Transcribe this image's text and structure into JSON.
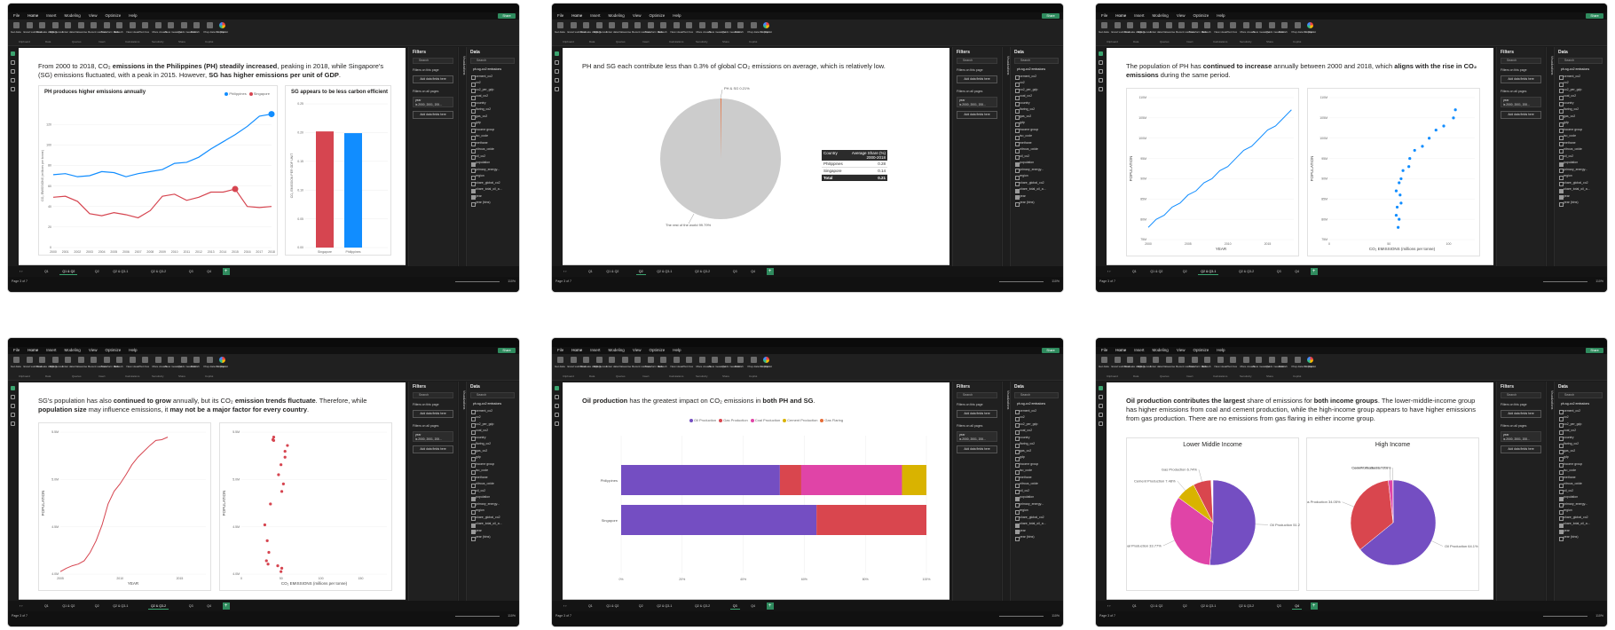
{
  "menu": [
    "File",
    "Home",
    "Insert",
    "Modeling",
    "View",
    "Optimize",
    "Help"
  ],
  "share_label": "Share",
  "ribbon": {
    "buttons": [
      "Get data",
      "Excel workbook",
      "OneLake catalog",
      "SQL Server",
      "Enter data",
      "Dataverse",
      "Recent sources",
      "Transform data",
      "Refresh",
      "New visual",
      "Text box",
      "More visuals",
      "New measure",
      "Quick measure",
      "Publish",
      "Prep data for Copilot",
      "Copilot"
    ],
    "groups": [
      "Clipboard",
      "Data",
      "Queries",
      "Insert",
      "Calculations",
      "Sensitivity",
      "Share",
      "Copilot"
    ]
  },
  "filters_panel": {
    "title": "Filters",
    "search": "Search",
    "on_page": "Filters on this page",
    "all_pages": "Filters on all pages",
    "add_fields": "Add data fields here",
    "year_label": "year",
    "year_value": "is 2000, 2001, 200..."
  },
  "viz_label": "Visualizations",
  "data_panel": {
    "title": "Data",
    "search": "Search",
    "table": "ph-sg-co2 emissions",
    "fields": [
      "cement_co2",
      "co2",
      "co2_per_gdp",
      "coal_co2",
      "country",
      "flaring_co2",
      "gas_co2",
      "gdp",
      "income group",
      "iso_code",
      "methane",
      "nitrous_oxide",
      "oil_co2",
      "population",
      "primary_energy...",
      "region",
      "share_global_co2",
      "share_total_oil_a...",
      "year",
      "year (bins)"
    ],
    "checked": [
      13,
      17,
      18
    ]
  },
  "page_tabs": [
    "Q1",
    "Q1 & Q2",
    "Q2",
    "Q2 & Q3-1",
    "Q2 & Q3-2",
    "Q3",
    "Q4"
  ],
  "status": {
    "page": "Page 3 of 7",
    "zoom": "110%"
  },
  "shots": [
    {
      "active_tab": 1,
      "headline_html": "From 2000 to 2018, CO₂ <b>emissions in the Philippines (PH) steadily increased</b>, peaking in 2018, while Singapore's (SG) emissions fluctuated, with a peak in 2015. However, <b>SG has higher emissions per unit of GDP</b>.",
      "line_card": {
        "title": "PH produces higher emissions annually",
        "legend": [
          "Philippines",
          "Singapore"
        ],
        "ylabel": "CO₂ EMISSIONS (millions per tonne)",
        "chart_data": {
          "type": "line",
          "x": [
            "2000",
            "2001",
            "2002",
            "2003",
            "2004",
            "2005",
            "2006",
            "2007",
            "2008",
            "2009",
            "2010",
            "2011",
            "2012",
            "2013",
            "2014",
            "2015",
            "2016",
            "2017",
            "2018"
          ],
          "series": [
            {
              "name": "Philippines",
              "values": [
                71,
                72,
                69,
                70,
                74,
                73,
                69,
                72,
                74,
                76,
                82,
                83,
                88,
                96,
                103,
                110,
                118,
                128,
                130
              ]
            },
            {
              "name": "Singapore",
              "values": [
                49,
                50,
                45,
                33,
                31,
                34,
                32,
                29,
                36,
                50,
                52,
                46,
                49,
                54,
                54,
                57,
                40,
                39,
                40
              ]
            }
          ],
          "ylim": [
            0,
            140
          ],
          "yticks": [
            0,
            20,
            40,
            60,
            80,
            100,
            120
          ]
        }
      },
      "bar_card": {
        "title": "SG appears to be less carbon efficient",
        "ylabel": "CO₂ EMISSION PER GDP UNIT",
        "chart_data": {
          "type": "bar",
          "categories": [
            "Singapore",
            "Philippines"
          ],
          "values": [
            0.202,
            0.199
          ],
          "ylim": [
            0,
            0.25
          ],
          "yticks": [
            "0.00",
            "0.05",
            "0.10",
            "0.15",
            "0.20",
            "0.25"
          ]
        }
      }
    },
    {
      "active_tab": 2,
      "headline_html": "PH and SG each contribute less than 0.3% of global CO₂ emissions on average, which is relatively low.",
      "pie": {
        "chart_data": {
          "type": "pie",
          "labels": [
            "PH & SG",
            "The rest of the world"
          ],
          "values": [
            0.21,
            99.79
          ]
        },
        "label_small": "PH & SG 0.21%",
        "label_big": "The rest of the world 99.79%"
      },
      "table": {
        "headers": [
          "Country",
          "Average Share (%) 2000-2018"
        ],
        "rows": [
          [
            "Philippines",
            "0.28"
          ],
          [
            "Singapore",
            "0.14"
          ]
        ],
        "total": [
          "Total",
          "0.21"
        ]
      }
    },
    {
      "active_tab": 3,
      "headline_html": "The population of PH has <b>continued to increase</b> annually between 2000 and 2018, which <b>aligns with the rise in CO₂ emissions</b> during the same period.",
      "left": {
        "xlabel": "YEAR",
        "ylabel": "POPULATION",
        "yticks": [
          "75M",
          "80M",
          "85M",
          "90M",
          "95M",
          "100M",
          "105M",
          "110M"
        ],
        "xticks": [
          "2000",
          "2005",
          "2010",
          "2015"
        ]
      },
      "right": {
        "xlabel": "CO₂ EMISSIONS (millions per tonne)",
        "ylabel": "POPULATION",
        "yticks": [
          "75M",
          "80M",
          "85M",
          "90M",
          "95M",
          "100M",
          "105M",
          "110M"
        ],
        "xticks": [
          "0",
          "50",
          "100"
        ]
      },
      "chart_data": {
        "type": "line",
        "x": [
          2000,
          2001,
          2002,
          2003,
          2004,
          2005,
          2006,
          2007,
          2008,
          2009,
          2010,
          2011,
          2012,
          2013,
          2014,
          2015,
          2016,
          2017,
          2018
        ],
        "series": [
          {
            "name": "Philippines",
            "population_m": [
              78,
              80,
              81,
              83,
              84,
              86,
              87,
              89,
              90,
              92,
              93,
              95,
              97,
              98,
              100,
              102,
              103,
              105,
              107
            ],
            "co2": [
              71,
              72,
              69,
              70,
              74,
              73,
              69,
              72,
              74,
              76,
              82,
              83,
              88,
              96,
              103,
              110,
              118,
              128,
              130
            ]
          }
        ]
      }
    },
    {
      "active_tab": 4,
      "headline_html": "SG's population has also <b>continued to grow</b> annually, but its CO₂ <b>emission trends fluctuate</b>. Therefore, while <b>population size</b> may influence emissions, it <b>may not be a major factor for every country</b>.",
      "left": {
        "xlabel": "YEAR",
        "ylabel": "POPULATION",
        "yticks": [
          "4.0M",
          "4.5M",
          "5.0M",
          "5.5M"
        ],
        "xticks": [
          "2005",
          "2010",
          "2015"
        ]
      },
      "right": {
        "xlabel": "CO₂ EMISSIONS (millions per tonne)",
        "ylabel": "POPULATION",
        "yticks": [
          "4.0M",
          "4.5M",
          "5.0M",
          "5.5M"
        ],
        "xticks": [
          "0",
          "50",
          "100",
          "150"
        ]
      },
      "chart_data": {
        "type": "line",
        "x": [
          2000,
          2001,
          2002,
          2003,
          2004,
          2005,
          2006,
          2007,
          2008,
          2009,
          2010,
          2011,
          2012,
          2013,
          2014,
          2015,
          2016,
          2017,
          2018
        ],
        "series": [
          {
            "name": "Singapore",
            "population_m": [
              4.03,
              4.07,
              4.1,
              4.12,
              4.16,
              4.26,
              4.4,
              4.59,
              4.84,
              4.99,
              5.08,
              5.19,
              5.31,
              5.4,
              5.47,
              5.54,
              5.6,
              5.61,
              5.64
            ],
            "co2": [
              49,
              50,
              45,
              33,
              31,
              34,
              32,
              29,
              36,
              50,
              52,
              46,
              49,
              54,
              54,
              57,
              40,
              39,
              40
            ]
          }
        ]
      }
    },
    {
      "active_tab": 5,
      "headline_html": "<b>Oil production</b> has the greatest impact on CO₂ emissions in <b>both PH and SG</b>.",
      "legend": [
        "Oil Production",
        "Gas Production",
        "Coal Production",
        "Cement Production",
        "Gas Flaring"
      ],
      "xticks": [
        "0%",
        "20%",
        "40%",
        "60%",
        "80%",
        "100%"
      ],
      "chart_data": {
        "type": "bar",
        "categories": [
          "Philippines",
          "Singapore"
        ],
        "series": [
          {
            "name": "Oil Production",
            "values": [
              52,
              64
            ]
          },
          {
            "name": "Gas Production",
            "values": [
              7,
              36
            ]
          },
          {
            "name": "Coal Production",
            "values": [
              33,
              0
            ]
          },
          {
            "name": "Cement Production",
            "values": [
              8,
              0
            ]
          },
          {
            "name": "Gas Flaring",
            "values": [
              0,
              0
            ]
          }
        ]
      }
    },
    {
      "active_tab": 6,
      "headline_html": "<b>Oil production contributes the largest</b> share of emissions for <b>both income groups</b>. The lower-middle-income group has higher emissions from coal and cement production, while the high-income group appears to have higher emissions from gas production. There are no emissions from gas flaring in either income group.",
      "pies": [
        {
          "title": "Lower Middle Income",
          "labels": [
            "Oil Production 51.21%",
            "Coal Production 33.77%",
            "Cement Production 7.48%",
            "Gas Production 6.74%"
          ]
        },
        {
          "title": "High Income",
          "labels": [
            "Oil Production 64.1%",
            "Gas Production 34.05%",
            "Coal Production 1.72%",
            "Cement Production 0.1%"
          ]
        }
      ],
      "chart_data": [
        {
          "type": "pie",
          "title": "Lower Middle Income",
          "labels": [
            "Oil Production",
            "Coal Production",
            "Cement Production",
            "Gas Production"
          ],
          "values": [
            51.21,
            33.77,
            7.48,
            6.74
          ]
        },
        {
          "type": "pie",
          "title": "High Income",
          "labels": [
            "Oil Production",
            "Gas Production",
            "Coal Production",
            "Cement Production"
          ],
          "values": [
            64.1,
            34.05,
            1.72,
            0.1
          ]
        }
      ]
    }
  ],
  "colors": {
    "ph": "#118dff",
    "sg": "#d64550",
    "oil": "#744ec2",
    "gas": "#d9464e",
    "coal": "#e044a7",
    "cement": "#d9b300",
    "flaring": "#e66c37",
    "pie_grey": "#cccccc"
  }
}
